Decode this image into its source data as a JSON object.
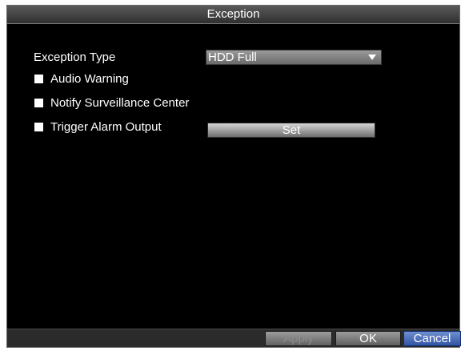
{
  "dialog": {
    "title": "Exception"
  },
  "form": {
    "exception_type_label": "Exception Type",
    "exception_type_value": "HDD Full",
    "options": [
      {
        "label": "Audio Warning",
        "checked": false
      },
      {
        "label": "Notify Surveillance Center",
        "checked": false
      },
      {
        "label": "Trigger Alarm Output",
        "checked": false
      }
    ],
    "set_button_label": "Set"
  },
  "footer": {
    "apply_label": "Apply",
    "ok_label": "OK",
    "cancel_label": "Cancel"
  },
  "colors": {
    "background": "#000000",
    "text": "#ffffff",
    "cancel_accent": "#3255a3"
  }
}
